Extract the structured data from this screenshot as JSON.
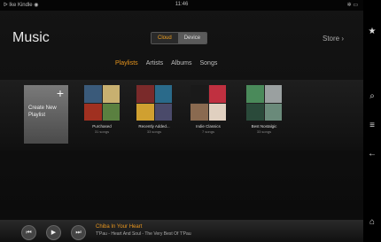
{
  "status": {
    "left": "ᐅ Ike Kindle ◉",
    "time": "11:46",
    "right": "✲ ▭"
  },
  "header": {
    "title": "Music",
    "store": "Store ›"
  },
  "source_toggle": {
    "cloud": "Cloud",
    "device": "Device"
  },
  "tabs": [
    "Playlists",
    "Artists",
    "Albums",
    "Songs"
  ],
  "create_playlist": {
    "label": "Create New Playlist",
    "plus": "+"
  },
  "playlists": [
    {
      "name": "Purchased",
      "count": "31 songs"
    },
    {
      "name": "Recently Added...",
      "count": "33 songs"
    },
    {
      "name": "Indie Classics",
      "count": "7 songs"
    },
    {
      "name": "Best Nostalgic",
      "count": "33 songs"
    }
  ],
  "player": {
    "title": "Chiba In Your Heart",
    "subtitle": "T'Pau - Heart And Soul - The Very Best Of T'Pau",
    "prev": "⏮",
    "play": "▶",
    "next": "⏭"
  },
  "sidebar": {
    "star": "★",
    "search": "⌕",
    "menu": "≡",
    "back": "←",
    "home": "⌂"
  },
  "colors": {
    "accent": "#e8961e",
    "background": "#0f0f0f"
  }
}
